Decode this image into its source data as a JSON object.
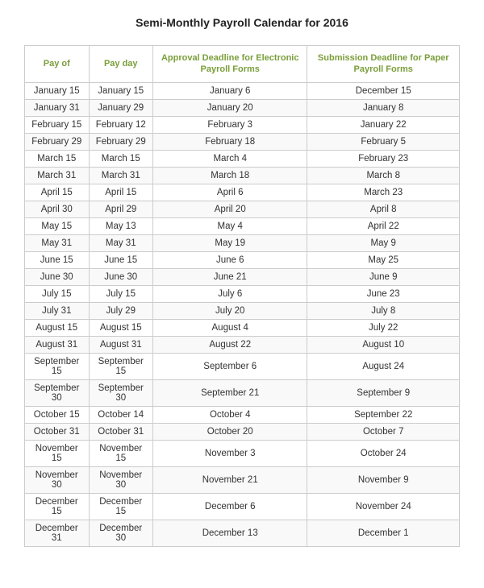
{
  "title": "Semi-Monthly Payroll Calendar for 2016",
  "headers": {
    "col1": "Pay of",
    "col2": "Pay day",
    "col3": "Approval Deadline for Electronic Payroll Forms",
    "col4": "Submission Deadline for Paper Payroll Forms"
  },
  "rows": [
    [
      "January 15",
      "January 15",
      "January 6",
      "December 15"
    ],
    [
      "January 31",
      "January 29",
      "January 20",
      "January 8"
    ],
    [
      "February 15",
      "February 12",
      "February 3",
      "January 22"
    ],
    [
      "February 29",
      "February 29",
      "February 18",
      "February 5"
    ],
    [
      "March 15",
      "March 15",
      "March 4",
      "February 23"
    ],
    [
      "March 31",
      "March 31",
      "March 18",
      "March 8"
    ],
    [
      "April 15",
      "April 15",
      "April 6",
      "March 23"
    ],
    [
      "April 30",
      "April 29",
      "April 20",
      "April 8"
    ],
    [
      "May 15",
      "May 13",
      "May 4",
      "April 22"
    ],
    [
      "May 31",
      "May 31",
      "May 19",
      "May 9"
    ],
    [
      "June 15",
      "June 15",
      "June 6",
      "May 25"
    ],
    [
      "June 30",
      "June 30",
      "June 21",
      "June 9"
    ],
    [
      "July 15",
      "July 15",
      "July 6",
      "June 23"
    ],
    [
      "July 31",
      "July 29",
      "July 20",
      "July 8"
    ],
    [
      "August 15",
      "August 15",
      "August 4",
      "July 22"
    ],
    [
      "August 31",
      "August 31",
      "August 22",
      "August 10"
    ],
    [
      "September 15",
      "September 15",
      "September 6",
      "August 24"
    ],
    [
      "September 30",
      "September 30",
      "September 21",
      "September 9"
    ],
    [
      "October 15",
      "October 14",
      "October 4",
      "September 22"
    ],
    [
      "October 31",
      "October 31",
      "October 20",
      "October 7"
    ],
    [
      "November 15",
      "November 15",
      "November 3",
      "October 24"
    ],
    [
      "November 30",
      "November 30",
      "November 21",
      "November 9"
    ],
    [
      "December 15",
      "December 15",
      "December 6",
      "November 24"
    ],
    [
      "December 31",
      "December 30",
      "December 13",
      "December 1"
    ]
  ]
}
